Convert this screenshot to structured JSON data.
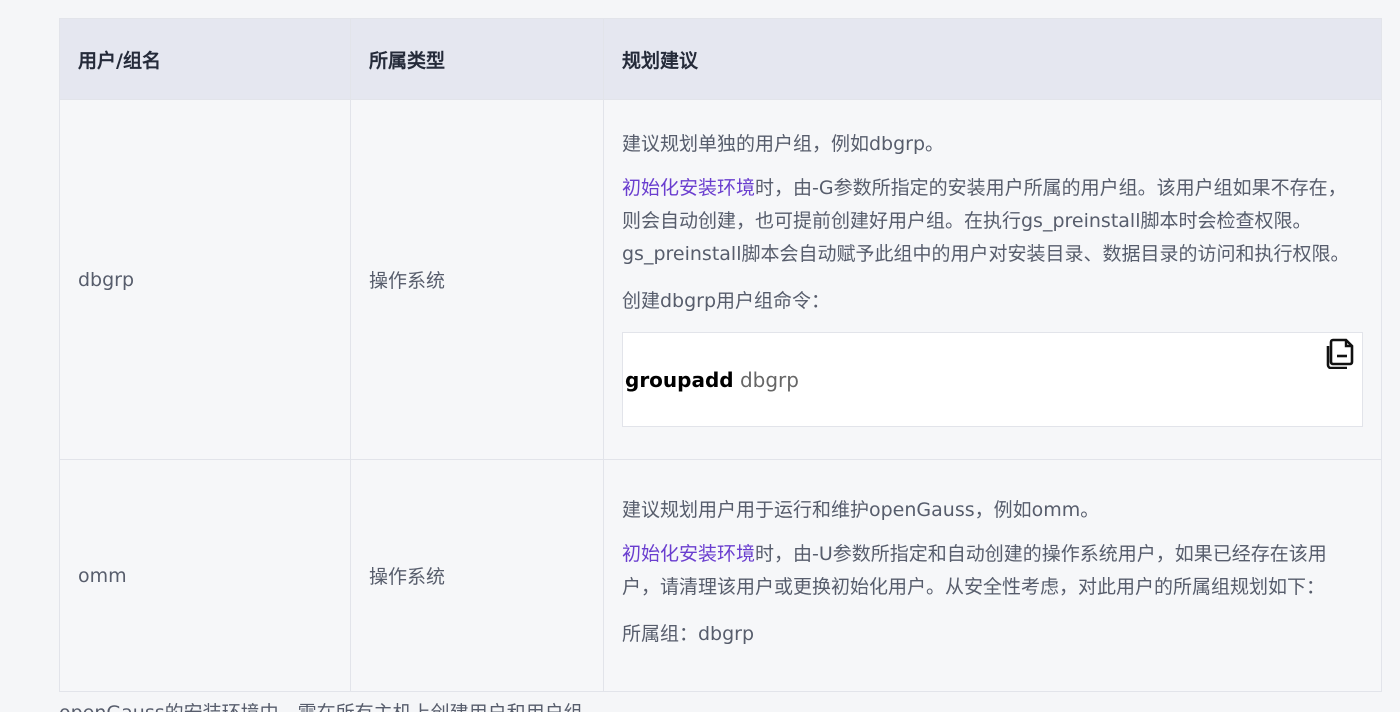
{
  "table": {
    "headers": [
      "用户/组名",
      "所属类型",
      "规划建议"
    ],
    "rows": [
      {
        "name": "dbgrp",
        "type": "操作系统",
        "advice": {
          "p1": "建议规划单独的用户组，例如dbgrp。",
          "p2_link": "初始化安装环境",
          "p2_text": "时，由-G参数所指定的安装用户所属的用户组。该用户组如果不存在，则会自动创建，也可提前创建好用户组。在执行gs_preinstall脚本时会检查权限。gs_preinstall脚本会自动赋予此组中的用户对安装目录、数据目录的访问和执行权限。",
          "p3": "创建dbgrp用户组命令：",
          "code_keyword": "groupadd",
          "code_arg": " dbgrp"
        }
      },
      {
        "name": "omm",
        "type": "操作系统",
        "advice": {
          "p1": "建议规划用户用于运行和维护openGauss，例如omm。",
          "p2_link": "初始化安装环境",
          "p2_text": "时，由-U参数所指定和自动创建的操作系统用户，如果已经存在该用户，请清理该用户或更换初始化用户。从安全性考虑，对此用户的所属组规划如下：",
          "p3": "所属组：dbgrp"
        }
      }
    ]
  },
  "icons": {
    "copy": "copy-icon"
  },
  "below_text": "openGauss的安装环境中，需在所有主机上创建用户和用户组。"
}
